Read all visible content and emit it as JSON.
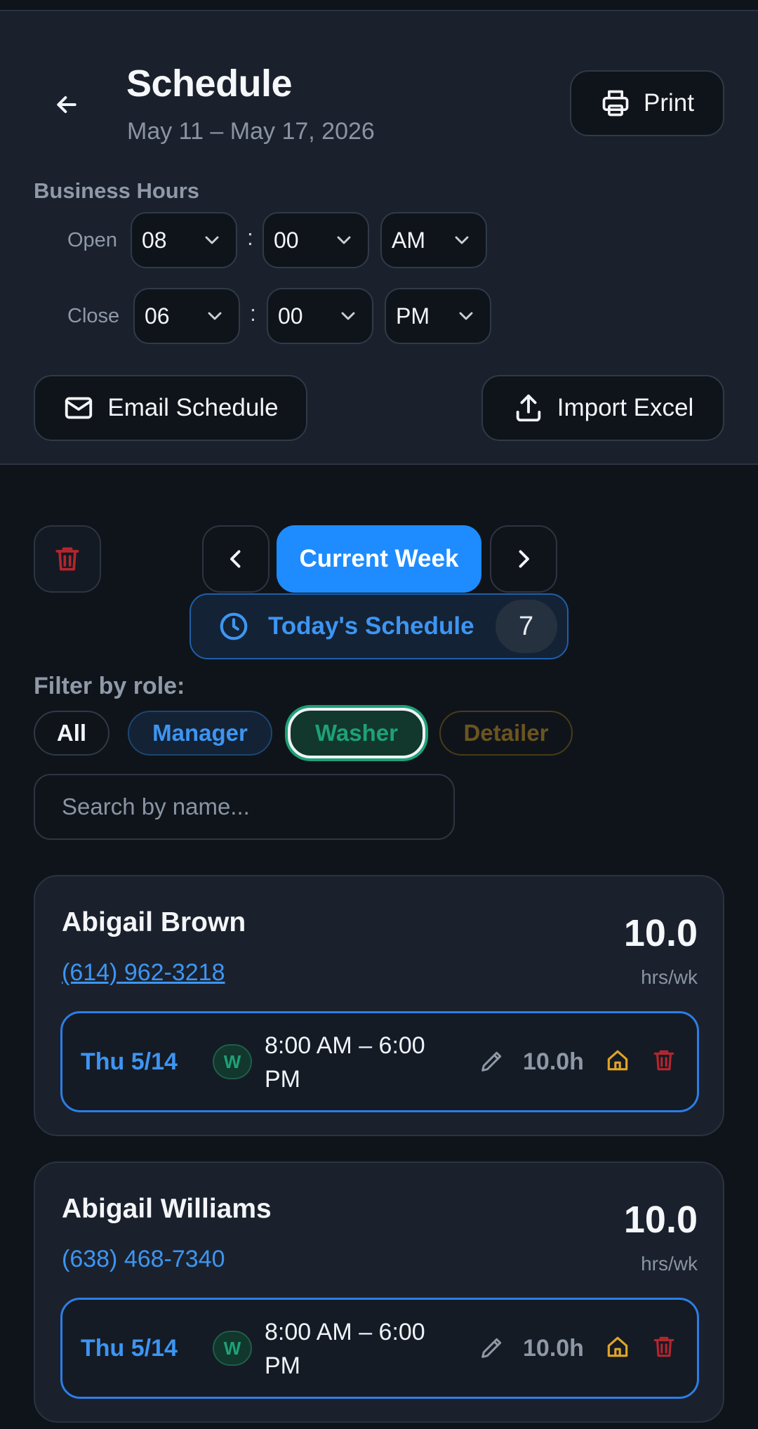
{
  "header": {
    "title": "Schedule",
    "date_range": "May 11 – May 17, 2026",
    "print_label": "Print"
  },
  "business_hours": {
    "label": "Business Hours",
    "open_label": "Open",
    "open_hour": "08",
    "open_minute": "00",
    "open_period": "AM",
    "close_label": "Close",
    "close_hour": "06",
    "close_minute": "00",
    "close_period": "PM",
    "separator": ":"
  },
  "actions": {
    "email_label": "Email Schedule",
    "import_label": "Import Excel"
  },
  "week_nav": {
    "current_label": "Current Week",
    "today_label": "Today's Schedule",
    "today_count": "7"
  },
  "filter": {
    "label": "Filter by role:",
    "chips": [
      "All",
      "Manager",
      "Washer",
      "Detailer"
    ],
    "selected": "Washer",
    "search_placeholder": "Search by name..."
  },
  "employees": [
    {
      "name": "Abigail Brown",
      "phone": "(614) 962-3218",
      "hours": "10.0",
      "hours_unit": "hrs/wk",
      "shift": {
        "day": "Thu 5/14",
        "role_badge": "W",
        "time_line1": "8:00 AM – 6:00",
        "time_line2": "PM",
        "duration": "10.0h"
      }
    },
    {
      "name": "Abigail Williams",
      "phone": "(638) 468-7340",
      "hours": "10.0",
      "hours_unit": "hrs/wk",
      "shift": {
        "day": "Thu 5/14",
        "role_badge": "W",
        "time_line1": "8:00 AM – 6:00",
        "time_line2": "PM",
        "duration": "10.0h"
      }
    }
  ],
  "colors": {
    "accent": "#1e8cff",
    "manager": "#3d95f2",
    "washer": "#1ea176",
    "detailer": "#6b5420",
    "danger": "#b3262e",
    "home": "#e0a526"
  }
}
